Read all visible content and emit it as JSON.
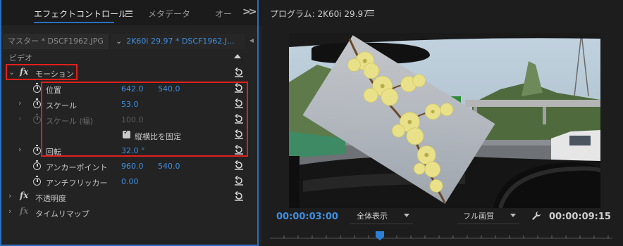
{
  "left_panel": {
    "tabs": [
      "エフェクトコントロール",
      "メタデータ",
      "オー"
    ],
    "master_label": "マスター * DSCF1962.JPG",
    "clip_label": "2K60i 29.97 * DSCF1962.J...",
    "section_header": "ビデオ",
    "effects": {
      "motion": "モーション",
      "position_label": "位置",
      "position_x": "642.0",
      "position_y": "540.0",
      "scale_label": "スケール",
      "scale_value": "53.0",
      "scale_width_label": "スケール (幅)",
      "scale_width_value": "100.0",
      "uniform_scale_label": "縦横比を固定",
      "rotation_label": "回転",
      "rotation_value": "32.0 °",
      "anchor_label": "アンカーポイント",
      "anchor_x": "960.0",
      "anchor_y": "540.0",
      "antiflicker_label": "アンチフリッカー",
      "antiflicker_value": "0.00",
      "opacity": "不透明度",
      "time_remap": "タイムリマップ"
    }
  },
  "right_panel": {
    "title": "プログラム: 2K60i 29.97",
    "current_time": "00:00:03:00",
    "zoom_select": "全体表示",
    "quality_select": "フル画質",
    "duration": "00:00:09:15"
  },
  "colors": {
    "accent_blue": "#3f8fe0",
    "highlight_red": "#e0201c"
  }
}
